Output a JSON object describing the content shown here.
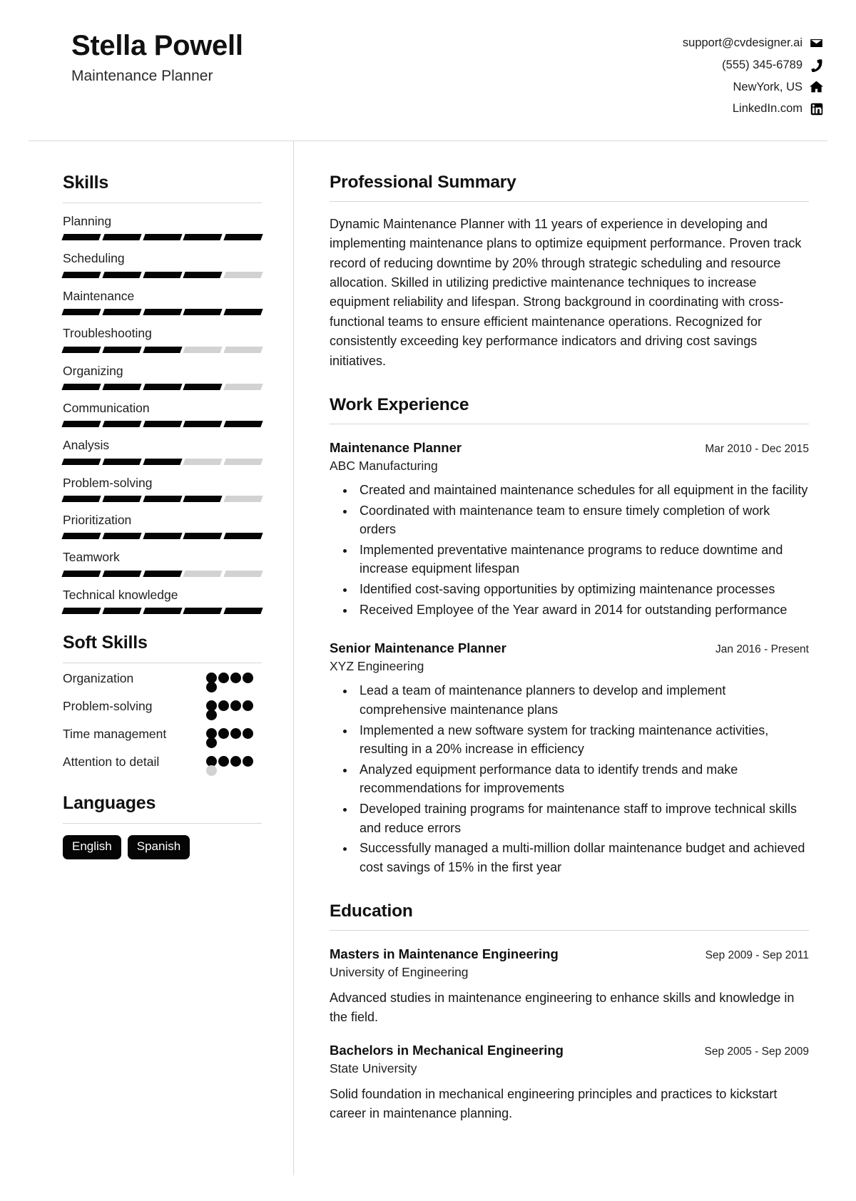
{
  "header": {
    "name": "Stella Powell",
    "title": "Maintenance Planner",
    "contacts": [
      {
        "icon": "envelope-icon",
        "value": "support@cvdesigner.ai"
      },
      {
        "icon": "phone-icon",
        "value": "(555) 345-6789"
      },
      {
        "icon": "home-icon",
        "value": "NewYork, US"
      },
      {
        "icon": "linkedin-icon",
        "value": "LinkedIn.com"
      }
    ]
  },
  "sidebar": {
    "skills": {
      "heading": "Skills",
      "max": 5,
      "items": [
        {
          "label": "Planning",
          "level": 5
        },
        {
          "label": "Scheduling",
          "level": 4
        },
        {
          "label": "Maintenance",
          "level": 5
        },
        {
          "label": "Troubleshooting",
          "level": 3
        },
        {
          "label": "Organizing",
          "level": 4
        },
        {
          "label": "Communication",
          "level": 5
        },
        {
          "label": "Analysis",
          "level": 3
        },
        {
          "label": "Problem-solving",
          "level": 4
        },
        {
          "label": "Prioritization",
          "level": 5
        },
        {
          "label": "Teamwork",
          "level": 3
        },
        {
          "label": "Technical knowledge",
          "level": 5
        }
      ]
    },
    "soft_skills": {
      "heading": "Soft Skills",
      "max": 5,
      "items": [
        {
          "label": "Organization",
          "level": 5
        },
        {
          "label": "Problem-solving",
          "level": 5
        },
        {
          "label": "Time management",
          "level": 5
        },
        {
          "label": "Attention to detail",
          "level": 4
        }
      ]
    },
    "languages": {
      "heading": "Languages",
      "items": [
        "English",
        "Spanish"
      ]
    }
  },
  "main": {
    "summary": {
      "heading": "Professional Summary",
      "text": "Dynamic Maintenance Planner with 11 years of experience in developing and implementing maintenance plans to optimize equipment performance. Proven track record of reducing downtime by 20% through strategic scheduling and resource allocation. Skilled in utilizing predictive maintenance techniques to increase equipment reliability and lifespan. Strong background in coordinating with cross-functional teams to ensure efficient maintenance operations. Recognized for consistently exceeding key performance indicators and driving cost savings initiatives."
    },
    "work": {
      "heading": "Work Experience",
      "entries": [
        {
          "title": "Maintenance Planner",
          "date": "Mar 2010 - Dec 2015",
          "org": "ABC Manufacturing",
          "bullets": [
            "Created and maintained maintenance schedules for all equipment in the facility",
            "Coordinated with maintenance team to ensure timely completion of work orders",
            "Implemented preventative maintenance programs to reduce downtime and increase equipment lifespan",
            "Identified cost-saving opportunities by optimizing maintenance processes",
            "Received Employee of the Year award in 2014 for outstanding performance"
          ]
        },
        {
          "title": "Senior Maintenance Planner",
          "date": "Jan 2016 - Present",
          "org": "XYZ Engineering",
          "bullets": [
            "Lead a team of maintenance planners to develop and implement comprehensive maintenance plans",
            "Implemented a new software system for tracking maintenance activities, resulting in a 20% increase in efficiency",
            "Analyzed equipment performance data to identify trends and make recommendations for improvements",
            "Developed training programs for maintenance staff to improve technical skills and reduce errors",
            "Successfully managed a multi-million dollar maintenance budget and achieved cost savings of 15% in the first year"
          ]
        }
      ]
    },
    "education": {
      "heading": "Education",
      "entries": [
        {
          "title": "Masters in Maintenance Engineering",
          "date": "Sep 2009 - Sep 2011",
          "org": "University of Engineering",
          "desc": "Advanced studies in maintenance engineering to enhance skills and knowledge in the field."
        },
        {
          "title": "Bachelors in Mechanical Engineering",
          "date": "Sep 2005 - Sep 2009",
          "org": "State University",
          "desc": "Solid foundation in mechanical engineering principles and practices to kickstart career in maintenance planning."
        }
      ]
    }
  }
}
